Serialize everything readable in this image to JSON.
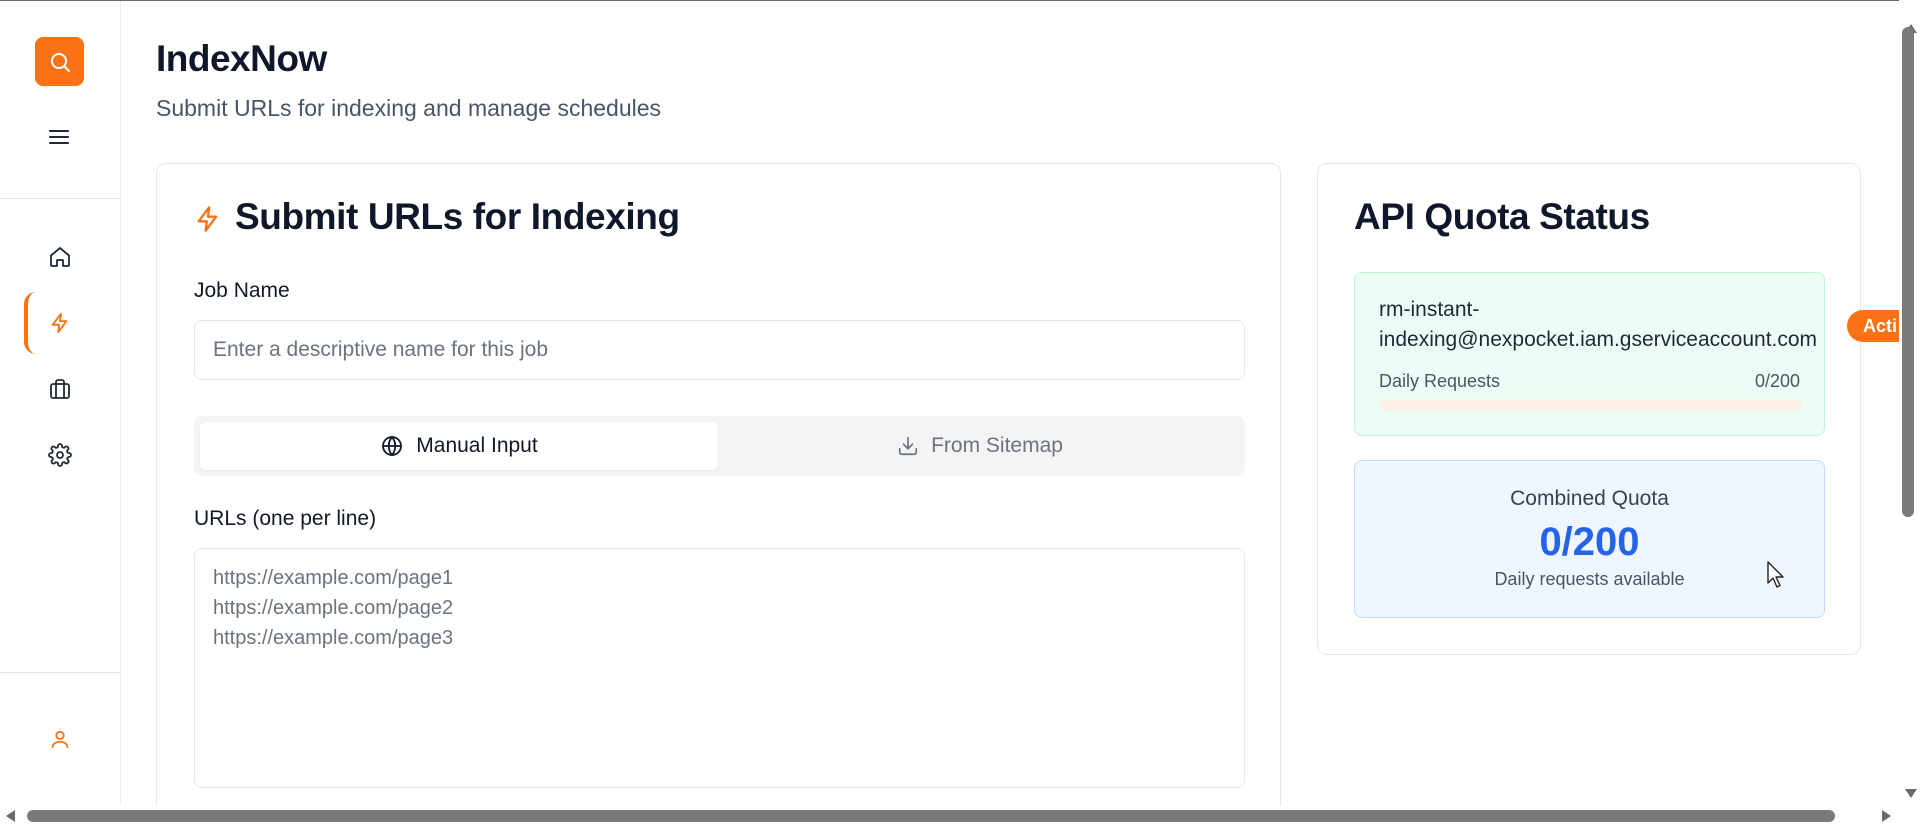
{
  "app": {
    "title": "IndexNow",
    "subtitle": "Submit URLs for indexing and manage schedules",
    "accent_color": "#f97316"
  },
  "sidebar": {
    "logo_icon": "search-icon",
    "menu_icon": "menu-icon",
    "items": [
      {
        "name": "home",
        "icon": "home-icon",
        "active": false
      },
      {
        "name": "indexnow",
        "icon": "bolt-icon",
        "active": true
      },
      {
        "name": "jobs",
        "icon": "briefcase-icon",
        "active": false
      },
      {
        "name": "settings",
        "icon": "gear-icon",
        "active": false
      }
    ],
    "profile_icon": "user-icon"
  },
  "submit_card": {
    "title": "Submit URLs for Indexing",
    "job_name_label": "Job Name",
    "job_name_placeholder": "Enter a descriptive name for this job",
    "job_name_value": "",
    "tabs": [
      {
        "label": "Manual Input",
        "icon": "globe-icon",
        "active": true
      },
      {
        "label": "From Sitemap",
        "icon": "download-icon",
        "active": false
      }
    ],
    "urls_label": "URLs (one per line)",
    "urls_placeholder_lines": [
      "https://example.com/page1",
      "https://example.com/page2",
      "https://example.com/page3"
    ]
  },
  "quota_card": {
    "title": "API Quota Status",
    "account": {
      "email_line1": "rm-instant-",
      "email_line2": "indexing@nexpocket.iam.gserviceaccount.com",
      "status": "Acti",
      "daily_requests_label": "Daily Requests",
      "daily_requests_value": "0/200",
      "usage_fraction": 0
    },
    "combined": {
      "label": "Combined Quota",
      "value": "0/200",
      "sub": "Daily requests available"
    }
  }
}
